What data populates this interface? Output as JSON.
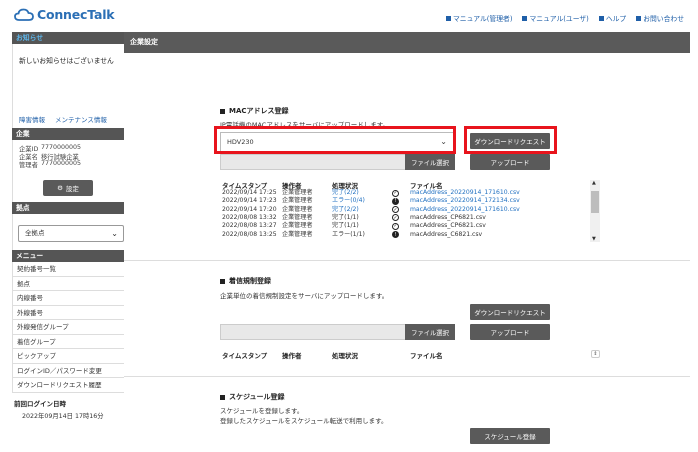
{
  "header": {
    "logo_text": "ConnecTalk",
    "links": [
      "マニュアル(管理者)",
      "マニュアル(ユーザ)",
      "ヘルプ",
      "お問い合わせ"
    ]
  },
  "sidebar": {
    "notice": {
      "title": "お知らせ",
      "text": "新しいお知らせはございません",
      "links": [
        "障害情報",
        "メンテナンス情報"
      ]
    },
    "company": {
      "title": "企業",
      "rows": [
        {
          "key": "企業ID",
          "value": "7770000005"
        },
        {
          "key": "企業名",
          "value": "移行試験企業"
        },
        {
          "key": "管理者",
          "value": "7770000005"
        }
      ],
      "settings_button": "設定"
    },
    "base": {
      "title": "拠点",
      "selected": "全拠点"
    },
    "menu": {
      "title": "メニュー",
      "items": [
        "契約番号一覧",
        "拠点",
        "内線番号",
        "外線番号",
        "外線発信グループ",
        "着信グループ",
        "ピックアップ",
        "ログインID／パスワード変更",
        "ダウンロードリクエスト履歴"
      ]
    },
    "last_login": {
      "title": "前回ログイン日時",
      "value": "2022年09月14日 17時16分"
    }
  },
  "main": {
    "title": "企業設定",
    "mac": {
      "title": "MACアドレス登録",
      "desc": "IP電話機のMACアドレスをサーバにアップロードします。",
      "select_value": "HDV230",
      "download_button": "ダウンロードリクエスト",
      "file_button": "ファイル選択",
      "upload_button": "アップロード",
      "columns": [
        "タイムスタンプ",
        "操作者",
        "処理状況",
        "ファイル名"
      ],
      "rows": [
        {
          "ts": "2022/09/14 17:25",
          "op": "企業管理者",
          "status": "完了(2/2)",
          "status_link": true,
          "icon": "check",
          "file": "macAddress_20220914_171610.csv",
          "file_link": true
        },
        {
          "ts": "2022/09/14 17:23",
          "op": "企業管理者",
          "status": "エラー(0/4)",
          "status_link": true,
          "icon": "error",
          "file": "macAddress_20220914_172134.csv",
          "file_link": true
        },
        {
          "ts": "2022/09/14 17:20",
          "op": "企業管理者",
          "status": "完了(2/2)",
          "status_link": true,
          "icon": "check",
          "file": "macAddress_20220914_171610.csv",
          "file_link": true
        },
        {
          "ts": "2022/08/08 13:32",
          "op": "企業管理者",
          "status": "完了(1/1)",
          "status_link": false,
          "icon": "check",
          "file": "macAddress_CP6821.csv",
          "file_link": false
        },
        {
          "ts": "2022/08/08 13:27",
          "op": "企業管理者",
          "status": "完了(1/1)",
          "status_link": false,
          "icon": "check",
          "file": "macAddress_CP6821.csv",
          "file_link": false
        },
        {
          "ts": "2022/08/08 13:25",
          "op": "企業管理者",
          "status": "エラー(1/1)",
          "status_link": false,
          "icon": "error",
          "file": "macAddress_C6821.csv",
          "file_link": false
        }
      ]
    },
    "incoming": {
      "title": "着信規制登録",
      "desc": "企業単位の着信規制設定をサーバにアップロードします。",
      "download_button": "ダウンロードリクエスト",
      "file_button": "ファイル選択",
      "upload_button": "アップロード",
      "columns": [
        "タイムスタンプ",
        "操作者",
        "処理状況",
        "ファイル名"
      ]
    },
    "schedule": {
      "title": "スケジュール登録",
      "desc1": "スケジュールを登録します。",
      "desc2": "登録したスケジュールをスケジュール転送で利用します。",
      "button": "スケジュール登録"
    }
  },
  "colors": {
    "accent": "#1f5fa8",
    "highlight": "#e8141c",
    "dark": "#5a5a5a"
  }
}
